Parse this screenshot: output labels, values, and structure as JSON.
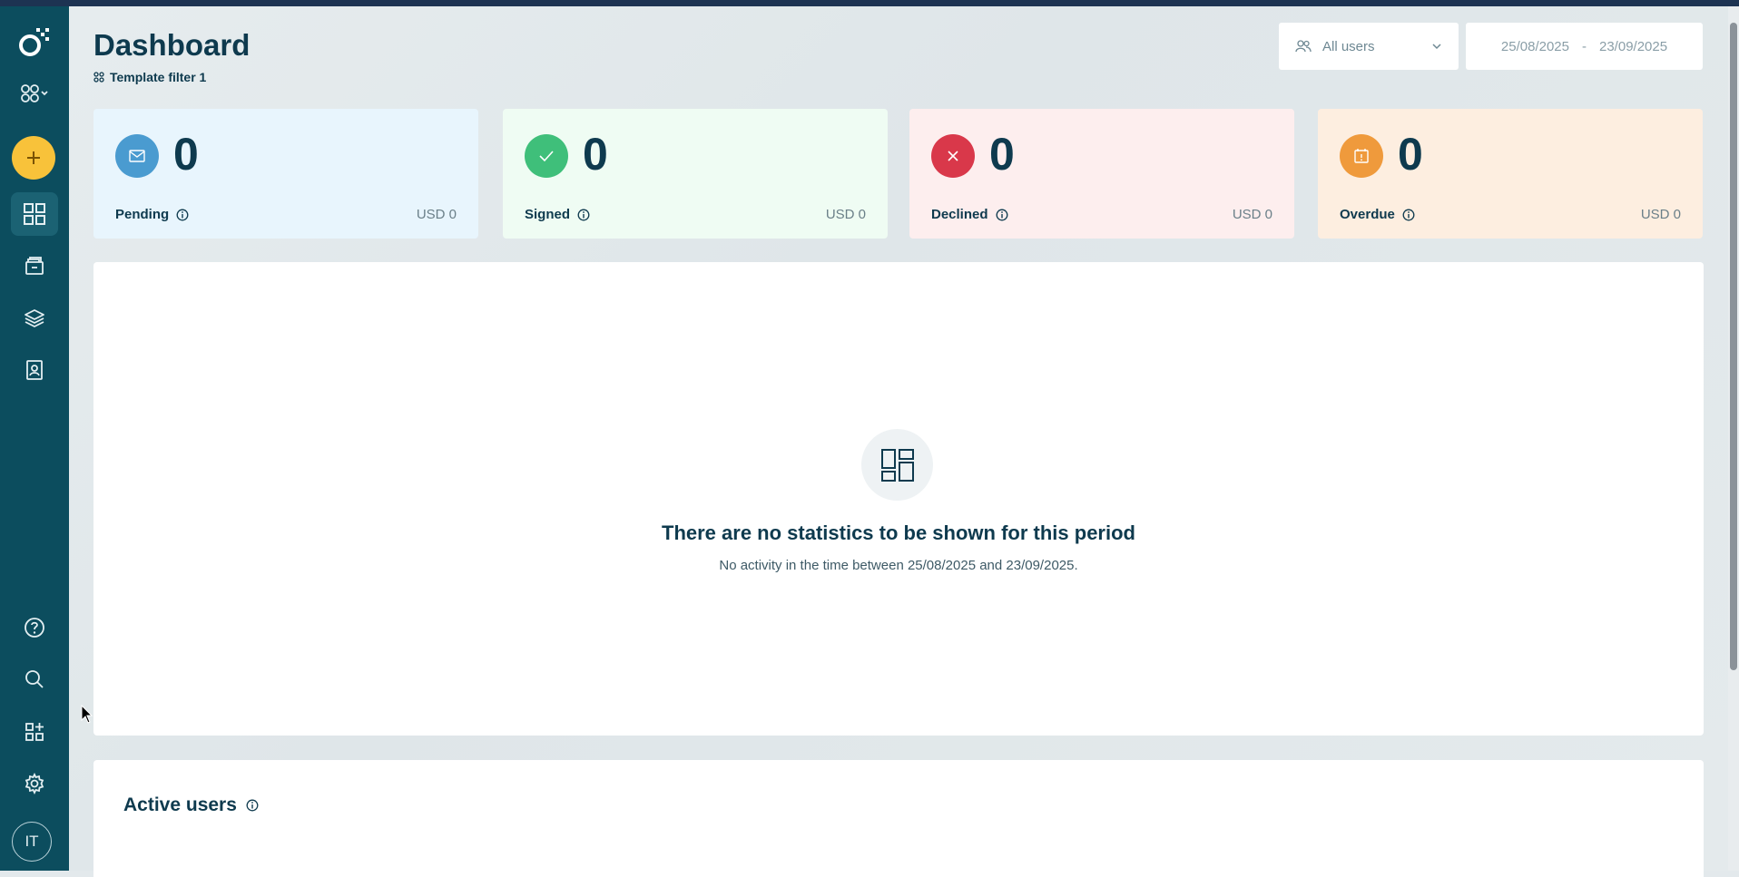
{
  "header": {
    "title": "Dashboard",
    "template_filter": "Template filter 1"
  },
  "filters": {
    "users_label": "All users",
    "date_from": "25/08/2025",
    "date_separator": "-",
    "date_to": "23/09/2025"
  },
  "cards": [
    {
      "name": "Pending",
      "count": "0",
      "amount": "USD 0",
      "icon": "mail-icon",
      "color": "#4a9bd0",
      "bg": "#e8f5fd"
    },
    {
      "name": "Signed",
      "count": "0",
      "amount": "USD 0",
      "icon": "check-icon",
      "color": "#3fbf7a",
      "bg": "#effcf3"
    },
    {
      "name": "Declined",
      "count": "0",
      "amount": "USD 0",
      "icon": "close-icon",
      "color": "#d9384a",
      "bg": "#fdeeee"
    },
    {
      "name": "Overdue",
      "count": "0",
      "amount": "USD 0",
      "icon": "calendar-alert-icon",
      "color": "#ef9a3c",
      "bg": "#fdeee0"
    }
  ],
  "empty_state": {
    "title": "There are no statistics to be shown for this period",
    "subtitle": "No activity in the time between 25/08/2025 and 23/09/2025."
  },
  "active_users": {
    "title": "Active users"
  },
  "sidebar": {
    "avatar_initials": "IT",
    "icons": [
      "logo-icon",
      "workspace-switch-icon",
      "add-icon",
      "dashboard-icon",
      "documents-icon",
      "templates-icon",
      "contacts-icon",
      "help-icon",
      "search-icon",
      "integrations-icon",
      "settings-icon"
    ]
  },
  "colors": {
    "sidebar": "#0c4d5e",
    "accent": "#f8c23a",
    "title": "#0e3a4e"
  }
}
